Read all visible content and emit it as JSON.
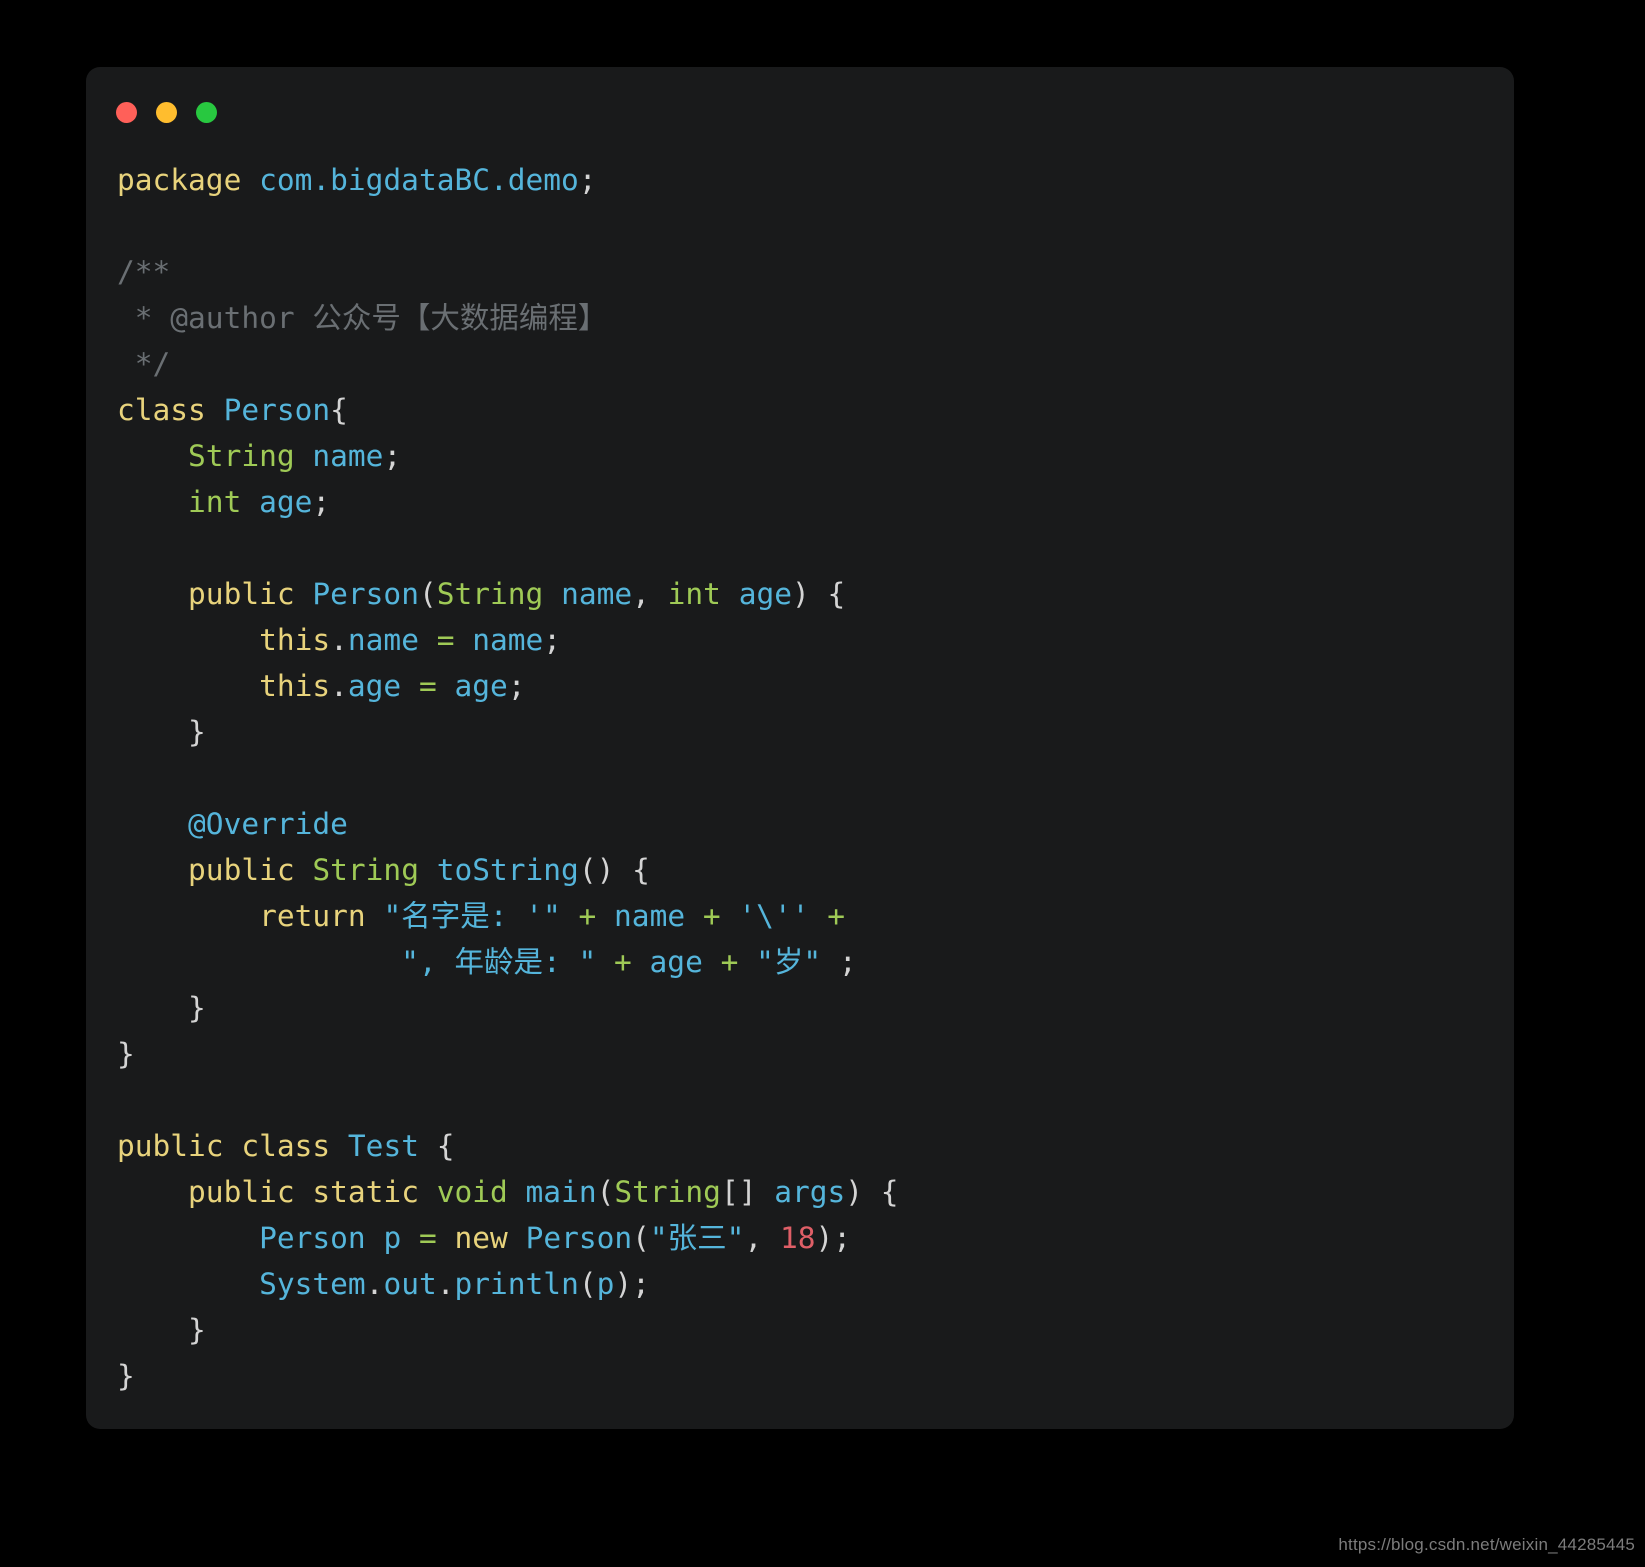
{
  "window": {
    "traffic_lights": [
      {
        "name": "close-button",
        "color": "#FF6059"
      },
      {
        "name": "minimize-button",
        "color": "#FFBD2E"
      },
      {
        "name": "maximize-button",
        "color": "#28C840"
      }
    ]
  },
  "palette": {
    "background": "#000000",
    "card": "#191A1B",
    "keyword": "#E8D37C",
    "type": "#9FCA56",
    "identifier": "#55B5DB",
    "string": "#55B5DB",
    "comment": "#6A6F73",
    "number": "#DF5F67",
    "operator": "#9FCA56",
    "punctuation": "#D4D4D4",
    "annotation": "#55B5DB"
  },
  "watermark": {
    "text": "https://blog.csdn.net/weixin_44285445"
  },
  "code": {
    "language": "java",
    "lines": [
      {
        "n": 1,
        "tokens": [
          {
            "t": "package",
            "c": "keyword"
          },
          {
            "t": " ",
            "c": "punctuation"
          },
          {
            "t": "com.bigdataBC.demo",
            "c": "identifier"
          },
          {
            "t": ";",
            "c": "punctuation"
          }
        ]
      },
      {
        "n": 2,
        "tokens": []
      },
      {
        "n": 3,
        "tokens": [
          {
            "t": "/**",
            "c": "comment"
          }
        ]
      },
      {
        "n": 4,
        "tokens": [
          {
            "t": " * @author 公众号【大数据编程】",
            "c": "comment"
          }
        ]
      },
      {
        "n": 5,
        "tokens": [
          {
            "t": " */",
            "c": "comment"
          }
        ]
      },
      {
        "n": 6,
        "tokens": [
          {
            "t": "class",
            "c": "keyword"
          },
          {
            "t": " ",
            "c": "punctuation"
          },
          {
            "t": "Person",
            "c": "identifier"
          },
          {
            "t": "{",
            "c": "punctuation"
          }
        ]
      },
      {
        "n": 7,
        "tokens": [
          {
            "t": "    ",
            "c": "punctuation"
          },
          {
            "t": "String",
            "c": "type"
          },
          {
            "t": " ",
            "c": "punctuation"
          },
          {
            "t": "name",
            "c": "identifier"
          },
          {
            "t": ";",
            "c": "punctuation"
          }
        ]
      },
      {
        "n": 8,
        "tokens": [
          {
            "t": "    ",
            "c": "punctuation"
          },
          {
            "t": "int",
            "c": "type"
          },
          {
            "t": " ",
            "c": "punctuation"
          },
          {
            "t": "age",
            "c": "identifier"
          },
          {
            "t": ";",
            "c": "punctuation"
          }
        ]
      },
      {
        "n": 9,
        "tokens": []
      },
      {
        "n": 10,
        "tokens": [
          {
            "t": "    ",
            "c": "punctuation"
          },
          {
            "t": "public",
            "c": "keyword"
          },
          {
            "t": " ",
            "c": "punctuation"
          },
          {
            "t": "Person",
            "c": "identifier"
          },
          {
            "t": "(",
            "c": "punctuation"
          },
          {
            "t": "String",
            "c": "type"
          },
          {
            "t": " ",
            "c": "punctuation"
          },
          {
            "t": "name",
            "c": "identifier"
          },
          {
            "t": ", ",
            "c": "punctuation"
          },
          {
            "t": "int",
            "c": "type"
          },
          {
            "t": " ",
            "c": "punctuation"
          },
          {
            "t": "age",
            "c": "identifier"
          },
          {
            "t": ") {",
            "c": "punctuation"
          }
        ]
      },
      {
        "n": 11,
        "tokens": [
          {
            "t": "        ",
            "c": "punctuation"
          },
          {
            "t": "this",
            "c": "keyword"
          },
          {
            "t": ".",
            "c": "punctuation"
          },
          {
            "t": "name",
            "c": "identifier"
          },
          {
            "t": " ",
            "c": "punctuation"
          },
          {
            "t": "=",
            "c": "operator"
          },
          {
            "t": " ",
            "c": "punctuation"
          },
          {
            "t": "name",
            "c": "identifier"
          },
          {
            "t": ";",
            "c": "punctuation"
          }
        ]
      },
      {
        "n": 12,
        "tokens": [
          {
            "t": "        ",
            "c": "punctuation"
          },
          {
            "t": "this",
            "c": "keyword"
          },
          {
            "t": ".",
            "c": "punctuation"
          },
          {
            "t": "age",
            "c": "identifier"
          },
          {
            "t": " ",
            "c": "punctuation"
          },
          {
            "t": "=",
            "c": "operator"
          },
          {
            "t": " ",
            "c": "punctuation"
          },
          {
            "t": "age",
            "c": "identifier"
          },
          {
            "t": ";",
            "c": "punctuation"
          }
        ]
      },
      {
        "n": 13,
        "tokens": [
          {
            "t": "    }",
            "c": "punctuation"
          }
        ]
      },
      {
        "n": 14,
        "tokens": []
      },
      {
        "n": 15,
        "tokens": [
          {
            "t": "    ",
            "c": "punctuation"
          },
          {
            "t": "@Override",
            "c": "annotation"
          }
        ]
      },
      {
        "n": 16,
        "tokens": [
          {
            "t": "    ",
            "c": "punctuation"
          },
          {
            "t": "public",
            "c": "keyword"
          },
          {
            "t": " ",
            "c": "punctuation"
          },
          {
            "t": "String",
            "c": "type"
          },
          {
            "t": " ",
            "c": "punctuation"
          },
          {
            "t": "toString",
            "c": "identifier"
          },
          {
            "t": "() {",
            "c": "punctuation"
          }
        ]
      },
      {
        "n": 17,
        "tokens": [
          {
            "t": "        ",
            "c": "punctuation"
          },
          {
            "t": "return",
            "c": "keyword"
          },
          {
            "t": " ",
            "c": "punctuation"
          },
          {
            "t": "\"名字是: '\"",
            "c": "string"
          },
          {
            "t": " ",
            "c": "punctuation"
          },
          {
            "t": "+",
            "c": "operator"
          },
          {
            "t": " ",
            "c": "punctuation"
          },
          {
            "t": "name",
            "c": "identifier"
          },
          {
            "t": " ",
            "c": "punctuation"
          },
          {
            "t": "+",
            "c": "operator"
          },
          {
            "t": " ",
            "c": "punctuation"
          },
          {
            "t": "'\\''",
            "c": "string"
          },
          {
            "t": " ",
            "c": "punctuation"
          },
          {
            "t": "+",
            "c": "operator"
          }
        ]
      },
      {
        "n": 18,
        "tokens": [
          {
            "t": "                ",
            "c": "punctuation"
          },
          {
            "t": "\", 年龄是: \"",
            "c": "string"
          },
          {
            "t": " ",
            "c": "punctuation"
          },
          {
            "t": "+",
            "c": "operator"
          },
          {
            "t": " ",
            "c": "punctuation"
          },
          {
            "t": "age",
            "c": "identifier"
          },
          {
            "t": " ",
            "c": "punctuation"
          },
          {
            "t": "+",
            "c": "operator"
          },
          {
            "t": " ",
            "c": "punctuation"
          },
          {
            "t": "\"岁\"",
            "c": "string"
          },
          {
            "t": " ;",
            "c": "punctuation"
          }
        ]
      },
      {
        "n": 19,
        "tokens": [
          {
            "t": "    }",
            "c": "punctuation"
          }
        ]
      },
      {
        "n": 20,
        "tokens": [
          {
            "t": "}",
            "c": "punctuation"
          }
        ]
      },
      {
        "n": 21,
        "tokens": []
      },
      {
        "n": 22,
        "tokens": [
          {
            "t": "public",
            "c": "keyword"
          },
          {
            "t": " ",
            "c": "punctuation"
          },
          {
            "t": "class",
            "c": "keyword"
          },
          {
            "t": " ",
            "c": "punctuation"
          },
          {
            "t": "Test",
            "c": "identifier"
          },
          {
            "t": " {",
            "c": "punctuation"
          }
        ]
      },
      {
        "n": 23,
        "tokens": [
          {
            "t": "    ",
            "c": "punctuation"
          },
          {
            "t": "public",
            "c": "keyword"
          },
          {
            "t": " ",
            "c": "punctuation"
          },
          {
            "t": "static",
            "c": "keyword"
          },
          {
            "t": " ",
            "c": "punctuation"
          },
          {
            "t": "void",
            "c": "type"
          },
          {
            "t": " ",
            "c": "punctuation"
          },
          {
            "t": "main",
            "c": "identifier"
          },
          {
            "t": "(",
            "c": "punctuation"
          },
          {
            "t": "String",
            "c": "type"
          },
          {
            "t": "[] ",
            "c": "punctuation"
          },
          {
            "t": "args",
            "c": "identifier"
          },
          {
            "t": ") {",
            "c": "punctuation"
          }
        ]
      },
      {
        "n": 24,
        "tokens": [
          {
            "t": "        ",
            "c": "punctuation"
          },
          {
            "t": "Person",
            "c": "identifier"
          },
          {
            "t": " ",
            "c": "punctuation"
          },
          {
            "t": "p",
            "c": "identifier"
          },
          {
            "t": " ",
            "c": "punctuation"
          },
          {
            "t": "=",
            "c": "operator"
          },
          {
            "t": " ",
            "c": "punctuation"
          },
          {
            "t": "new",
            "c": "keyword"
          },
          {
            "t": " ",
            "c": "punctuation"
          },
          {
            "t": "Person",
            "c": "identifier"
          },
          {
            "t": "(",
            "c": "punctuation"
          },
          {
            "t": "\"张三\"",
            "c": "string"
          },
          {
            "t": ", ",
            "c": "punctuation"
          },
          {
            "t": "18",
            "c": "number"
          },
          {
            "t": ");",
            "c": "punctuation"
          }
        ]
      },
      {
        "n": 25,
        "tokens": [
          {
            "t": "        ",
            "c": "punctuation"
          },
          {
            "t": "System",
            "c": "identifier"
          },
          {
            "t": ".",
            "c": "punctuation"
          },
          {
            "t": "out",
            "c": "identifier"
          },
          {
            "t": ".",
            "c": "punctuation"
          },
          {
            "t": "println",
            "c": "identifier"
          },
          {
            "t": "(",
            "c": "punctuation"
          },
          {
            "t": "p",
            "c": "identifier"
          },
          {
            "t": ");",
            "c": "punctuation"
          }
        ]
      },
      {
        "n": 26,
        "tokens": [
          {
            "t": "    }",
            "c": "punctuation"
          }
        ]
      },
      {
        "n": 27,
        "tokens": [
          {
            "t": "}",
            "c": "punctuation"
          }
        ]
      }
    ]
  }
}
